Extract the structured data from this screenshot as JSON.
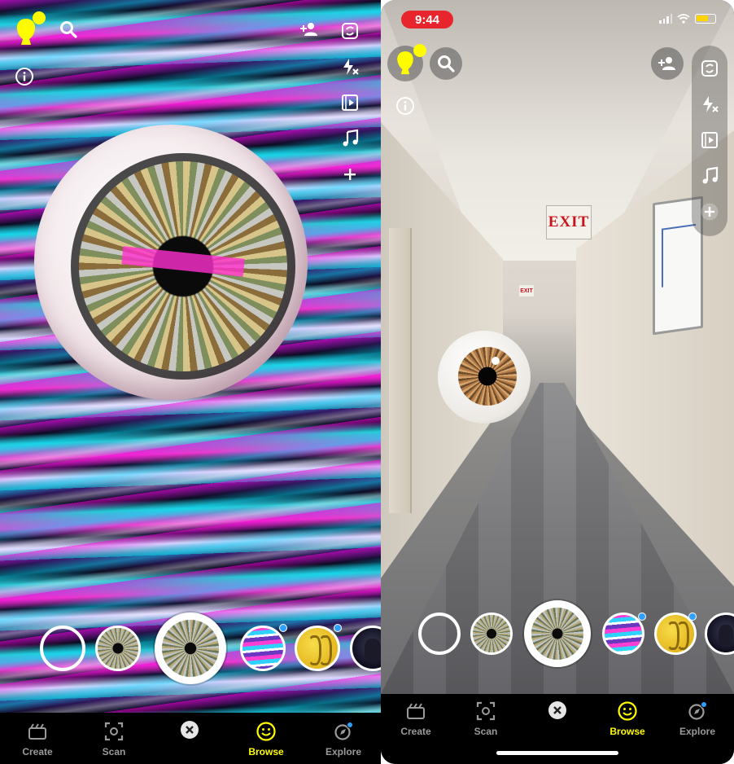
{
  "colors": {
    "brand_yellow": "#fffc00",
    "nav_inactive": "#9a9a9a",
    "recording_red": "#e8252c",
    "new_badge_blue": "#2fa0ff"
  },
  "left_screen": {
    "bottom_nav": {
      "create": "Create",
      "scan": "Scan",
      "browse": "Browse",
      "explore": "Explore"
    }
  },
  "right_screen": {
    "status_bar": {
      "time": "9:44"
    },
    "scene": {
      "exit_sign": "EXIT",
      "far_exit_sign": "EXIT"
    },
    "bottom_nav": {
      "create": "Create",
      "scan": "Scan",
      "browse": "Browse",
      "explore": "Explore"
    }
  },
  "icons": {
    "avatar": "bitmoji-avatar-icon",
    "search": "search-icon",
    "info": "info-icon",
    "add_friend": "add-friend-icon",
    "flip_camera": "flip-camera-icon",
    "flash_off": "flash-off-icon",
    "video_mode": "video-mode-icon",
    "music": "music-note-icon",
    "more": "plus-icon"
  },
  "active_tab": "Browse"
}
